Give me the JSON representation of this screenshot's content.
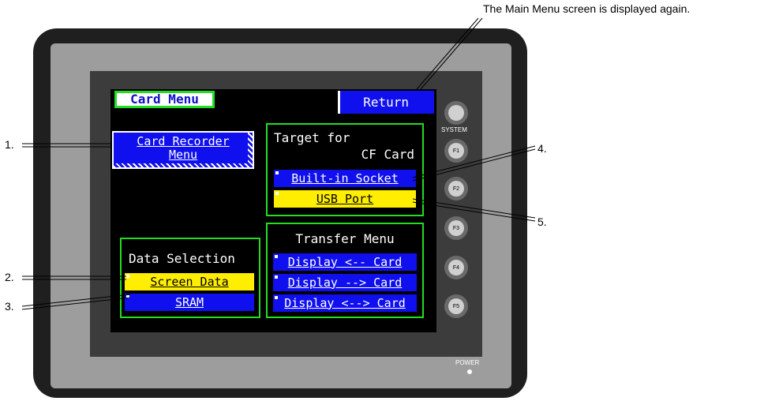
{
  "caption_top": "The Main Menu screen is displayed again.",
  "screen": {
    "title": "Card Menu",
    "return_label": "Return",
    "card_recorder": {
      "line1": "Card Recorder",
      "line2": "Menu"
    },
    "target": {
      "title_line1": "Target for",
      "title_line2": "CF Card",
      "builtin_label": "Built-in Socket",
      "usb_label": "USB Port"
    },
    "data_selection": {
      "title": "Data Selection",
      "screen_data_label": "Screen Data",
      "sram_label": "SRAM"
    },
    "transfer": {
      "title": "Transfer Menu",
      "items": [
        "Display <-- Card",
        "Display --> Card",
        "Display <--> Card"
      ]
    }
  },
  "device": {
    "system_label": "SYSTEM",
    "power_label": "POWER",
    "fkeys": [
      "F1",
      "F2",
      "F3",
      "F4",
      "F5"
    ]
  },
  "callouts": [
    "1.",
    "2.",
    "3.",
    "4.",
    "5."
  ]
}
